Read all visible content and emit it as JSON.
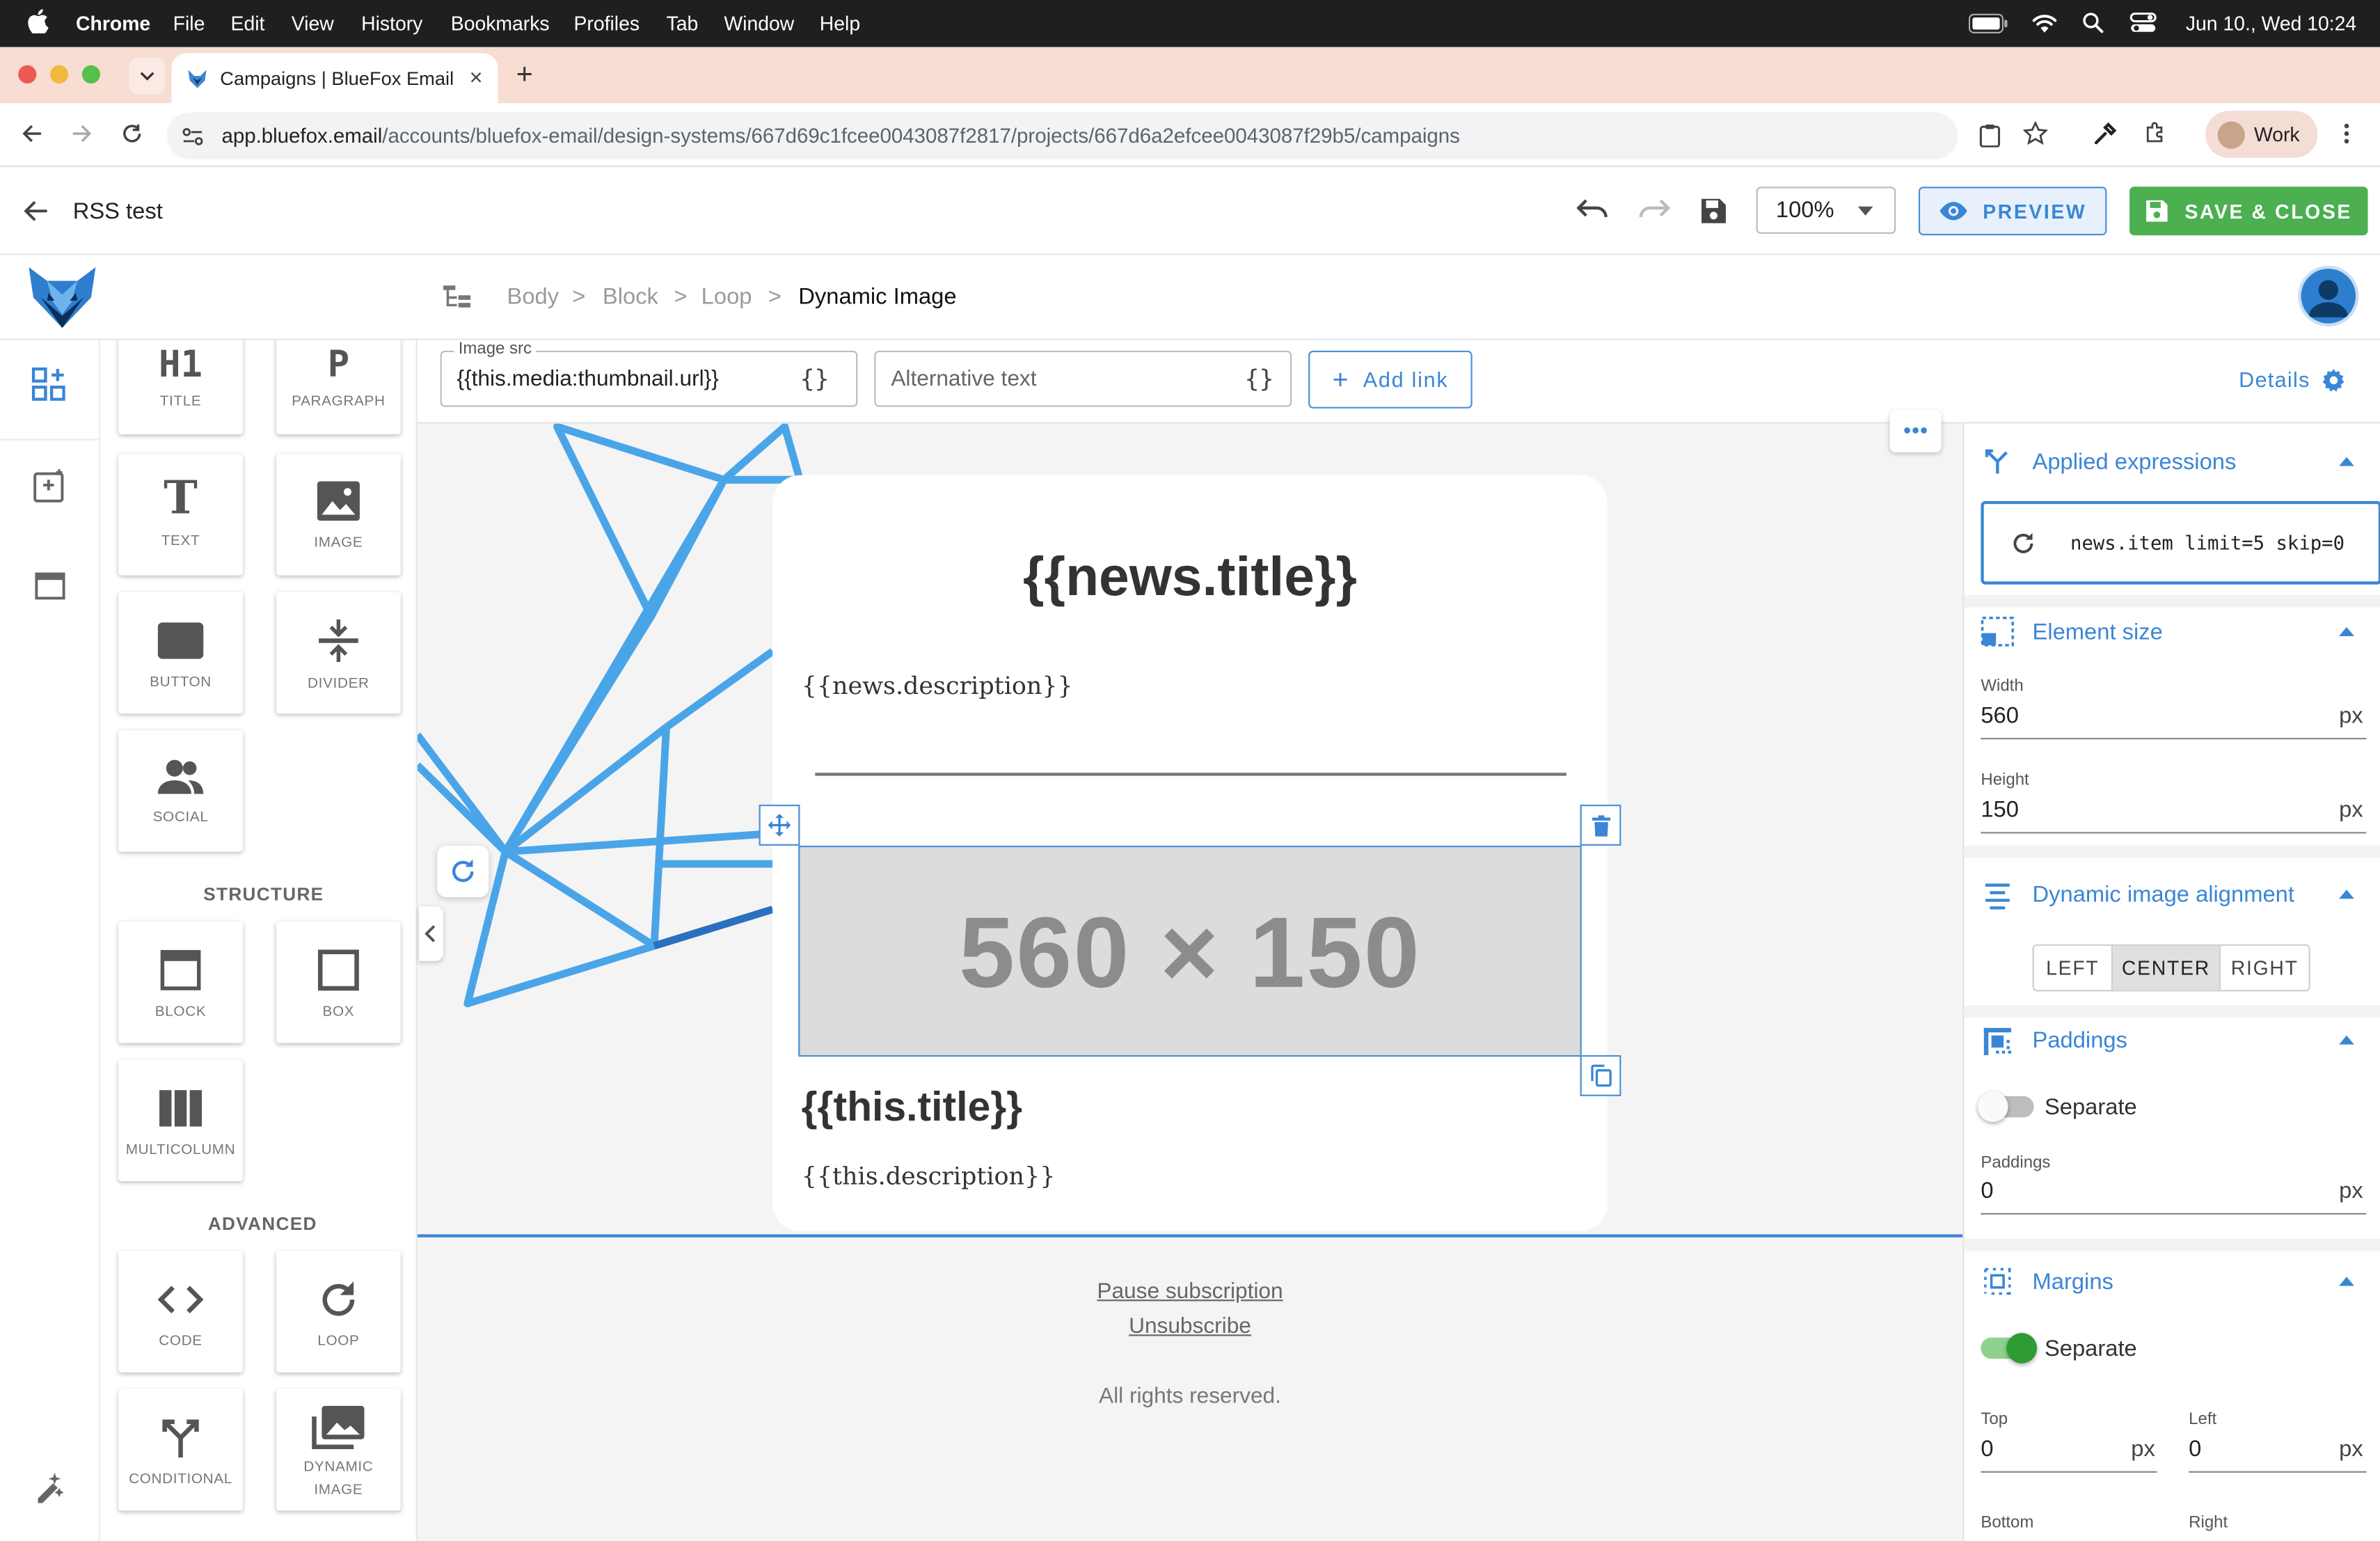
{
  "menubar": {
    "app": "Chrome",
    "items": [
      "File",
      "Edit",
      "View",
      "History",
      "Bookmarks",
      "Profiles",
      "Tab",
      "Window",
      "Help"
    ],
    "datetime": "Jun 10., Wed  10:24"
  },
  "browser": {
    "tab_title": "Campaigns | BlueFox Email",
    "url_host": "app.bluefox.email",
    "url_path": "/accounts/bluefox-email/design-systems/667d69c1fcee0043087f2817/projects/667d6a2efcee0043087f29b5/campaigns",
    "profile": "Work"
  },
  "header": {
    "title": "RSS test",
    "zoom": "100%",
    "preview_label": "PREVIEW",
    "save_label": "SAVE & CLOSE"
  },
  "breadcrumb": {
    "items": [
      "Body",
      "Block",
      "Loop"
    ],
    "current": "Dynamic Image",
    "separator": ">"
  },
  "blocks": {
    "tiles": {
      "title": {
        "glyph": "H1",
        "label": "TITLE"
      },
      "paragraph": {
        "glyph": "P",
        "label": "PARAGRAPH"
      },
      "text": {
        "glyph": "T",
        "label": "TEXT"
      },
      "image": {
        "label": "IMAGE"
      },
      "button": {
        "label": "BUTTON"
      },
      "divider": {
        "label": "DIVIDER"
      },
      "social": {
        "label": "SOCIAL"
      },
      "block": {
        "label": "BLOCK"
      },
      "box": {
        "label": "BOX"
      },
      "multicolumn": {
        "label": "MULTICOLUMN"
      },
      "code": {
        "label": "CODE"
      },
      "loop": {
        "label": "LOOP"
      },
      "conditional": {
        "label": "CONDITIONAL"
      },
      "dynamic_image_1": "DYNAMIC",
      "dynamic_image_2": "IMAGE"
    },
    "structure_heading": "STRUCTURE",
    "advanced_heading": "ADVANCED"
  },
  "toolbar": {
    "image_src_label": "Image src",
    "image_src_value": "{{this.media:thumbnail.url}}",
    "alt_placeholder": "Alternative text",
    "expr_icon": "{}",
    "add_link_label": "Add link",
    "details_label": "Details"
  },
  "canvas": {
    "news_title": "{{news.title}}",
    "news_description": "{{news.description}}",
    "placeholder_image": "560 × 150",
    "item_title": "{{this.title}}",
    "item_description": "{{this.description}}",
    "footer": {
      "pause": "Pause subscription",
      "unsubscribe": "Unsubscribe",
      "rights": "All rights reserved."
    }
  },
  "right_panel": {
    "applied_expressions": {
      "heading": "Applied expressions",
      "expression": "news.item limit=5 skip=0"
    },
    "element_size": {
      "heading": "Element size",
      "width_label": "Width",
      "width": "560",
      "height_label": "Height",
      "height": "150",
      "unit": "px"
    },
    "alignment": {
      "heading": "Dynamic image alignment",
      "options": [
        "LEFT",
        "CENTER",
        "RIGHT"
      ],
      "selected": "CENTER"
    },
    "paddings": {
      "heading": "Paddings",
      "separate_label": "Separate",
      "separate_on": false,
      "label": "Paddings",
      "value": "0",
      "unit": "px"
    },
    "margins": {
      "heading": "Margins",
      "separate_label": "Separate",
      "separate_on": true,
      "top_label": "Top",
      "top": "0",
      "left_label": "Left",
      "left": "0",
      "bottom_label": "Bottom",
      "right_label": "Right",
      "unit": "px"
    }
  },
  "colors": {
    "accent": "#3a86d6",
    "save": "#4caf50",
    "canvas_bg": "#f4f4f4",
    "tab_strip": "#f7ddd2",
    "selection": "#4a90d9"
  }
}
